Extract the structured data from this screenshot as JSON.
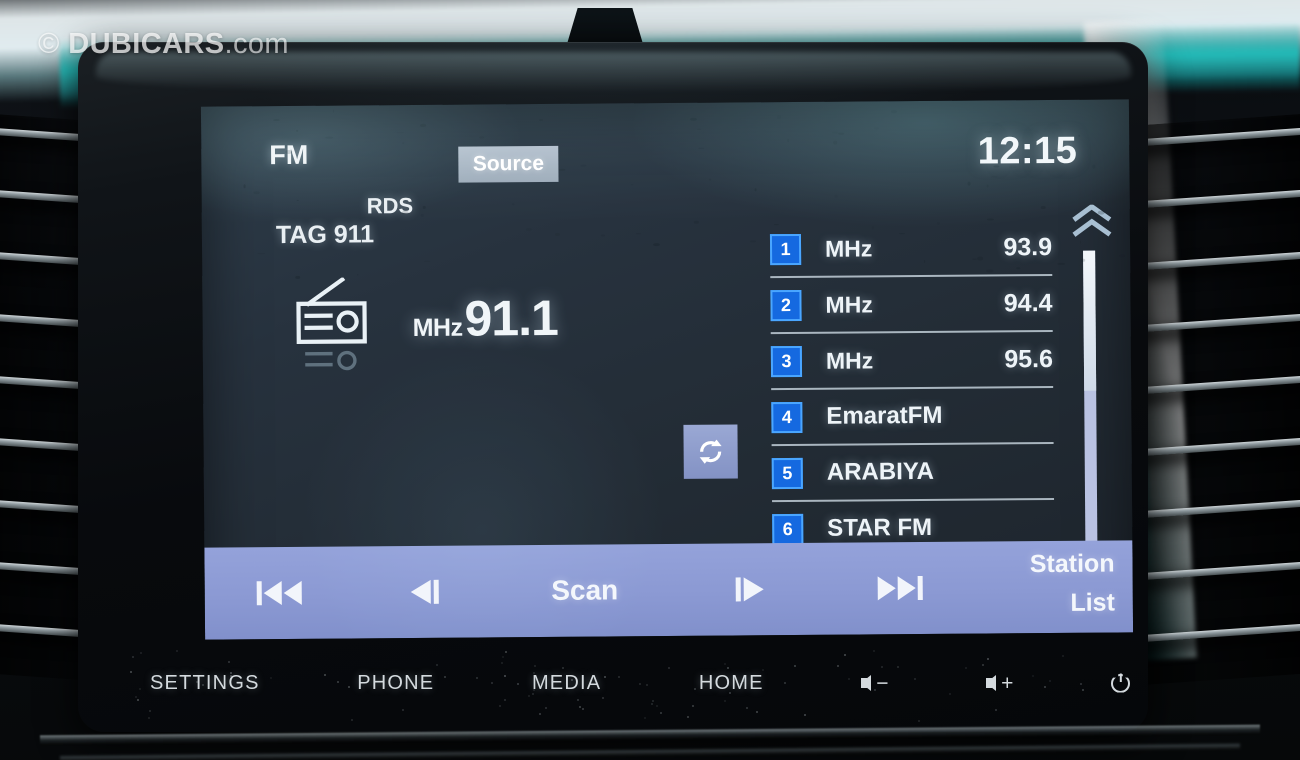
{
  "watermark": {
    "copyright": "©",
    "brand": "DUBICARS",
    "tld": ".com"
  },
  "screen": {
    "status": {
      "band": "FM",
      "source_label": "Source",
      "clock": "12:15",
      "rds": "RDS",
      "tag": "TAG 911"
    },
    "now_playing": {
      "unit": "MHz",
      "frequency": "91.1",
      "radio_icon": "radio-icon"
    },
    "refresh_icon": "refresh-icon",
    "presets": [
      {
        "number": "1",
        "unit": "MHz",
        "name": "",
        "value": "93.9"
      },
      {
        "number": "2",
        "unit": "MHz",
        "name": "",
        "value": "94.4"
      },
      {
        "number": "3",
        "unit": "MHz",
        "name": "",
        "value": "95.6"
      },
      {
        "number": "4",
        "unit": "",
        "name": "EmaratFM",
        "value": ""
      },
      {
        "number": "5",
        "unit": "",
        "name": "ARABIYA",
        "value": ""
      },
      {
        "number": "6",
        "unit": "",
        "name": "STAR FM",
        "value": ""
      }
    ],
    "scroll": {
      "up_icon": "chevron-up-icon",
      "down_icon": "chevron-down-icon",
      "up_state": "inactive",
      "down_state": "active"
    },
    "control_bar": {
      "prev_icon": "skip-previous-icon",
      "tune_down_icon": "tune-down-icon",
      "scan_label": "Scan",
      "tune_up_icon": "tune-up-icon",
      "next_icon": "skip-next-icon",
      "station_list_line1": "Station",
      "station_list_line2": "List"
    }
  },
  "hardware_buttons": [
    {
      "label": "SETTINGS",
      "icon": ""
    },
    {
      "label": "PHONE",
      "icon": ""
    },
    {
      "label": "MEDIA",
      "icon": ""
    },
    {
      "label": "HOME",
      "icon": ""
    },
    {
      "label": "",
      "icon": "volume-down-icon"
    },
    {
      "label": "",
      "icon": "volume-up-icon"
    },
    {
      "label": "",
      "icon": "power-icon"
    }
  ],
  "colors": {
    "screen_bg": "#27323e",
    "accent_blue": "#1569e0",
    "badge_border": "#4aa6ff",
    "control_bar": "#8b99d3",
    "source_btn": "#a6b3c1",
    "text_white": "#eef4f8",
    "chevron_active": "#1f8ffb",
    "chevron_inactive": "#9fb4c8"
  }
}
